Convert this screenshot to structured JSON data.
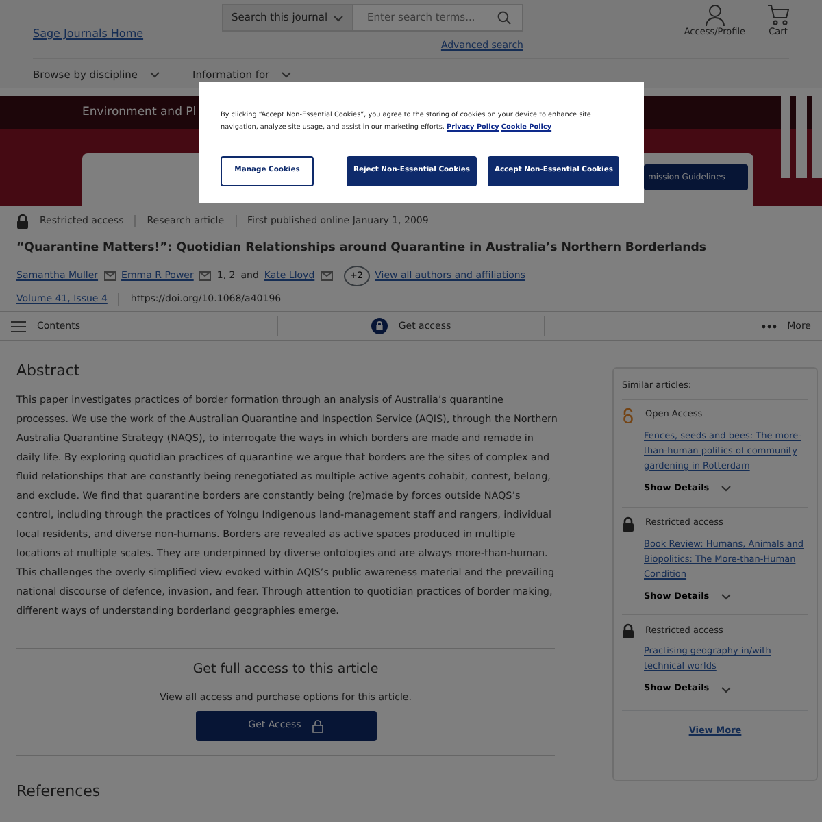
{
  "header": {
    "logo_link": "Sage Journals Home",
    "search_scope": "Search this journal",
    "search": {
      "placeholder": "Enter search terms..."
    },
    "advanced_search": "Advanced search",
    "account": [
      "Access/Profile",
      "Cart"
    ],
    "nav": [
      "Browse by discipline",
      "Information for"
    ]
  },
  "banner": {
    "journal_title": "Environment and Pl",
    "button": "mission Guidelines"
  },
  "article": {
    "meta": [
      "Restricted access",
      "Research article",
      "First published online January 1, 2009"
    ],
    "title": "“Quarantine Matters!”: Quotidian Relationships around Quarantine in Australia’s Northern Borderlands",
    "authors": [
      {
        "name": "Samantha Muller"
      },
      {
        "name": "Emma R Power",
        "note": "1, 2"
      },
      {
        "name": "Kate Lloyd"
      }
    ],
    "authors_joiner": "and",
    "more_authors": "+2",
    "all_authors_link": "View all authors and affiliations",
    "issue_link": "Volume 41, Issue 4",
    "doi": "https://doi.org/10.1068/a40196"
  },
  "toolbar": {
    "contents": "Contents",
    "get_access": "Get access",
    "more": "More"
  },
  "abstract": {
    "heading": "Abstract",
    "text": "This paper investigates practices of border formation through an analysis of Australia’s quarantine processes. We use the work of the Australian Quarantine and Inspection Service (AQIS), through the Northern Australia Quarantine Strategy (NAQS), to interrogate the ways in which borders are made and remade in daily life. By exploring quotidian practices of quarantine we argue that borders are the sites of complex and fluid relationships that are constantly being renegotiated as multiple active agents cohabit, contest, belong, and exclude. We find that quarantine borders are constantly being (re)made by forces outside NAQS’s control, including through the practices of Yolngu Indigenous land-management staff and rangers, individual local residents, and diverse non-humans. Borders are revealed as active spaces produced in multiple locations at multiple scales. They are underpinned by diverse ontologies and are always more-than-human. This challenges the overly simplified view evoked within AQIS’s public awareness material and the prevailing national discourse of defence, invasion, and fear. Through attention to quotidian practices of border making, different ways of understanding borderland geographies emerge."
  },
  "access_box": {
    "heading": "Get full access to this article",
    "text": "View all access and purchase options for this article.",
    "button": "Get Access"
  },
  "references_heading": "References",
  "similar": {
    "heading": "Similar articles:",
    "items": [
      {
        "kind": "open",
        "access": "Open Access",
        "title": "Fences, seeds and bees: The more-than-human politics of community gardening in Rotterdam",
        "details": "Show Details"
      },
      {
        "kind": "restricted",
        "access": "Restricted access",
        "title": "Book Review: Humans, Animals and Biopolitics: The More-than-Human Condition",
        "details": "Show Details"
      },
      {
        "kind": "restricted",
        "access": "Restricted access",
        "title": "Practising geography in/with technical worlds",
        "details": "Show Details"
      }
    ],
    "view_more": "View More"
  },
  "cookie_dialog": {
    "text": "By clicking “Accept Non-Essential Cookies”, you agree to the storing of cookies on your device to enhance site navigation, analyze site usage, and assist in our marketing efforts.",
    "links": [
      "Privacy Policy",
      "Cookie Policy"
    ],
    "buttons": [
      "Manage Cookies",
      "Reject Non-Essential Cookies",
      "Accept Non-Essential Cookies"
    ]
  }
}
